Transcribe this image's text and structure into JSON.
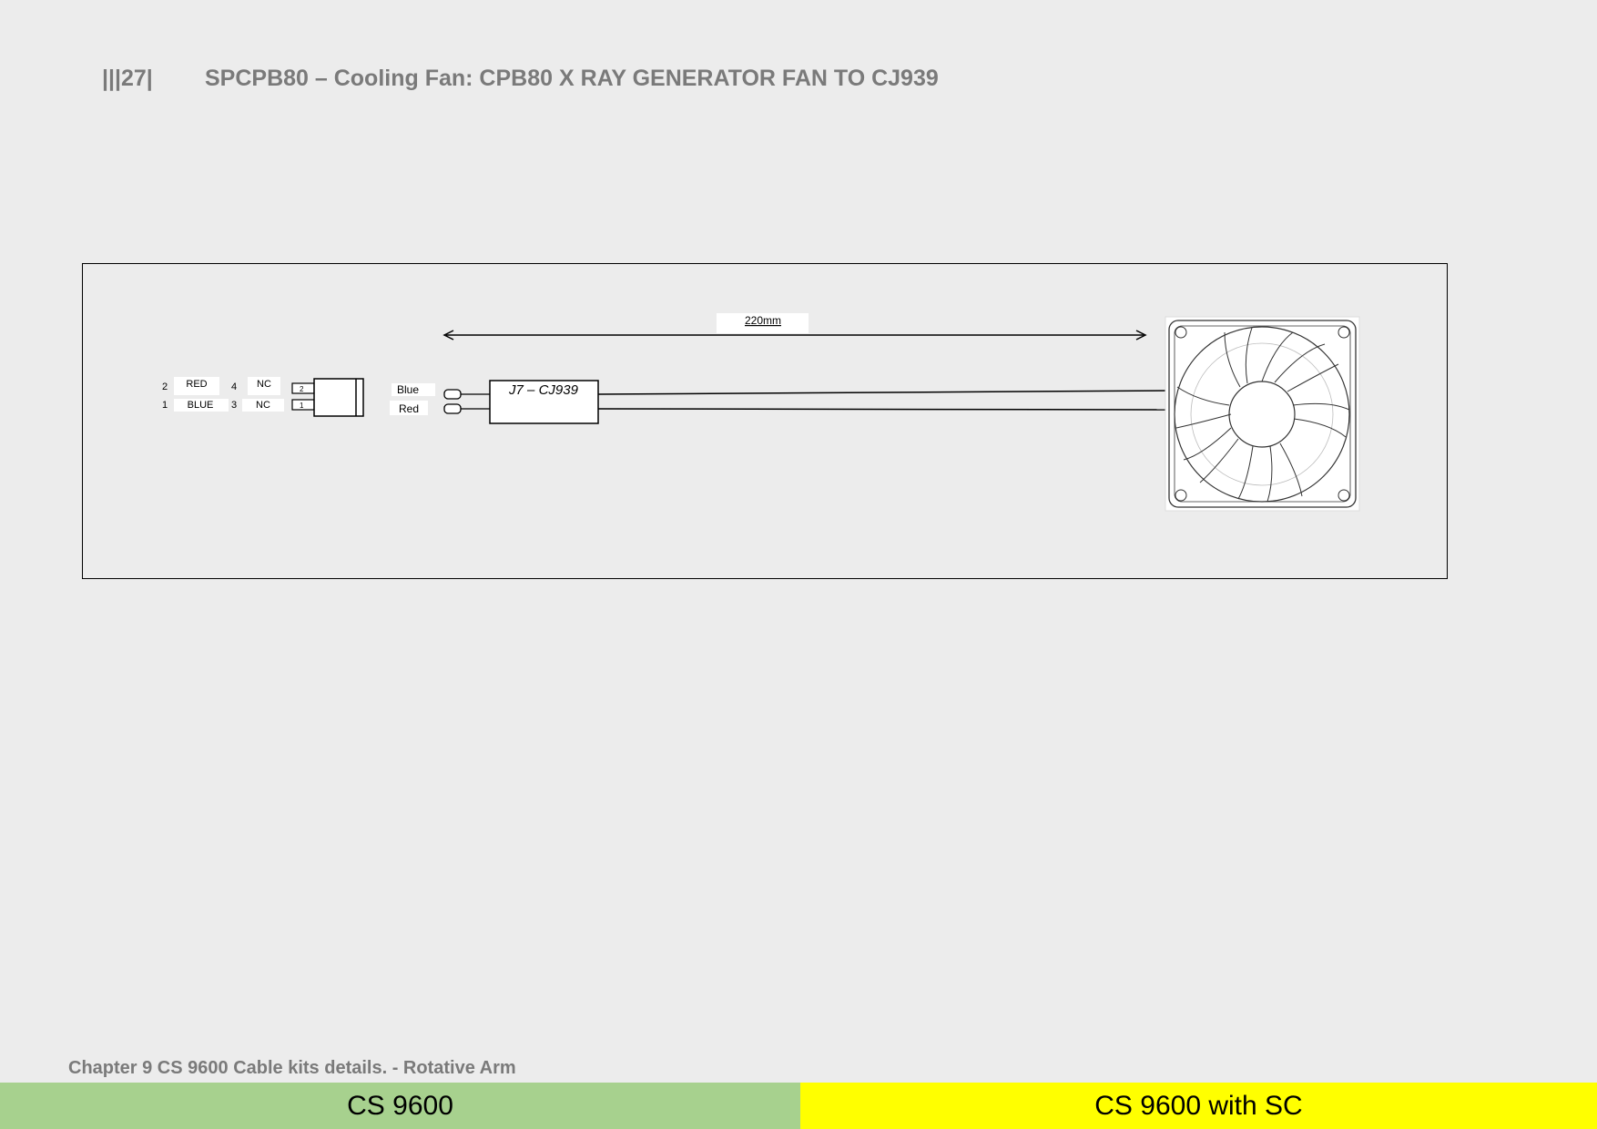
{
  "header": {
    "page_number": "|||27|",
    "title": "SPCPB80 – Cooling Fan: CPB80 X RAY GENERATOR FAN TO CJ939"
  },
  "diagram": {
    "length_label": "220mm",
    "pin_table": [
      {
        "pin": "2",
        "wire": "RED",
        "pin_b": "4",
        "wire_b": "NC"
      },
      {
        "pin": "1",
        "wire": "BLUE",
        "pin_b": "3",
        "wire_b": "NC"
      }
    ],
    "connector_pins": [
      "2",
      "1"
    ],
    "wire_labels": [
      "Blue",
      "Red"
    ],
    "connector_label": "J7 – CJ939"
  },
  "footer": {
    "chapter": "Chapter 9 CS 9600 Cable kits details. - Rotative Arm",
    "left_label": "CS 9600",
    "right_label": "CS 9600 with SC"
  },
  "colors": {
    "left_bar": "#a7d18e",
    "right_bar": "#ffff00",
    "header_text": "#7a7a7a"
  }
}
